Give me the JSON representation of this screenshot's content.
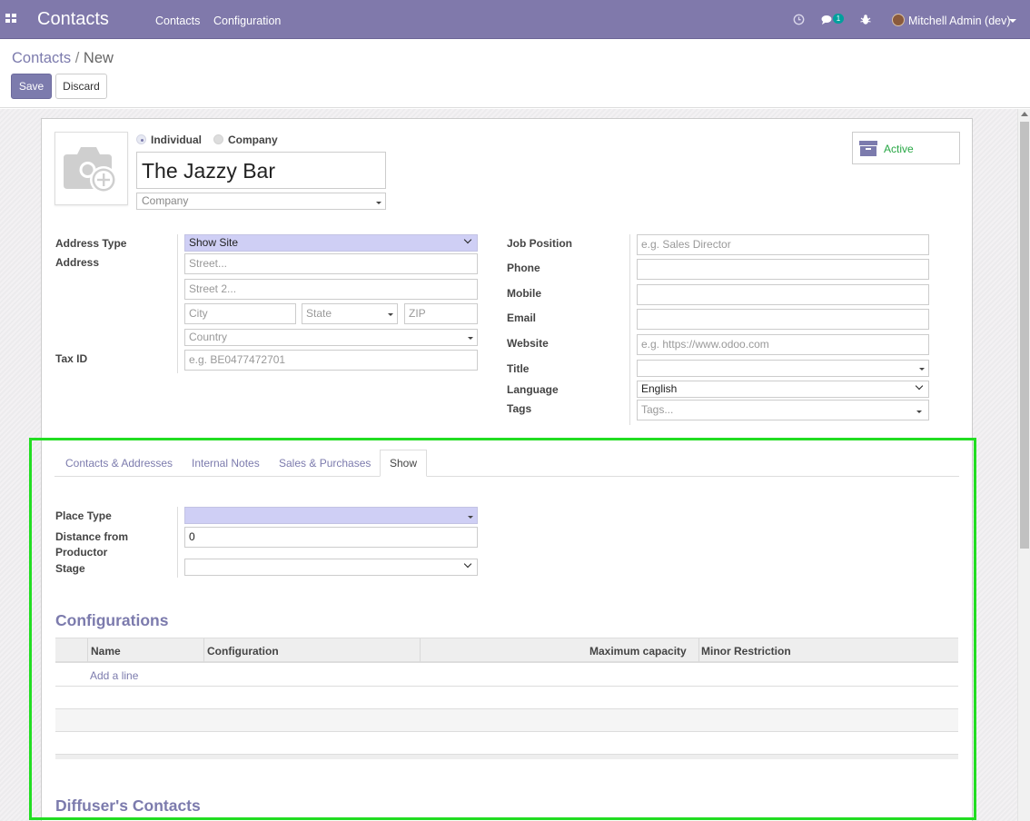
{
  "navbar": {
    "app_title": "Contacts",
    "menu": [
      "Contacts",
      "Configuration"
    ],
    "message_count": "1",
    "user": "Mitchell Admin (dev)"
  },
  "breadcrumb": {
    "parent": "Contacts",
    "separator": "/",
    "current": "New"
  },
  "buttons": {
    "save": "Save",
    "discard": "Discard"
  },
  "header": {
    "type_individual": "Individual",
    "type_company": "Company",
    "name": "The Jazzy Bar",
    "company_placeholder": "Company",
    "status": "Active"
  },
  "left_fields": {
    "address_type_label": "Address Type",
    "address_type_value": "Show Site",
    "address_label": "Address",
    "street_placeholder": "Street...",
    "street2_placeholder": "Street 2...",
    "city_placeholder": "City",
    "state_placeholder": "State",
    "zip_placeholder": "ZIP",
    "country_placeholder": "Country",
    "tax_id_label": "Tax ID",
    "tax_id_placeholder": "e.g. BE0477472701"
  },
  "right_fields": {
    "job_position_label": "Job Position",
    "job_position_placeholder": "e.g. Sales Director",
    "phone_label": "Phone",
    "mobile_label": "Mobile",
    "email_label": "Email",
    "website_label": "Website",
    "website_placeholder": "e.g. https://www.odoo.com",
    "title_label": "Title",
    "language_label": "Language",
    "language_value": "English",
    "tags_label": "Tags",
    "tags_placeholder": "Tags..."
  },
  "tabs": [
    "Contacts & Addresses",
    "Internal Notes",
    "Sales & Purchases",
    "Show"
  ],
  "show_tab": {
    "place_type_label": "Place Type",
    "distance_label_1": "Distance from",
    "distance_label_2": "Productor",
    "distance_value": "0",
    "stage_label": "Stage"
  },
  "configurations": {
    "title": "Configurations",
    "columns": [
      "Name",
      "Configuration",
      "Maximum capacity",
      "Minor Restriction"
    ],
    "add_line": "Add a line"
  },
  "diffusers": {
    "title": "Diffuser's Contacts"
  },
  "colors": {
    "brand": "#8079ab",
    "accent": "#7c7bad",
    "active": "#28a745",
    "highlight_frame": "#22dd22"
  }
}
